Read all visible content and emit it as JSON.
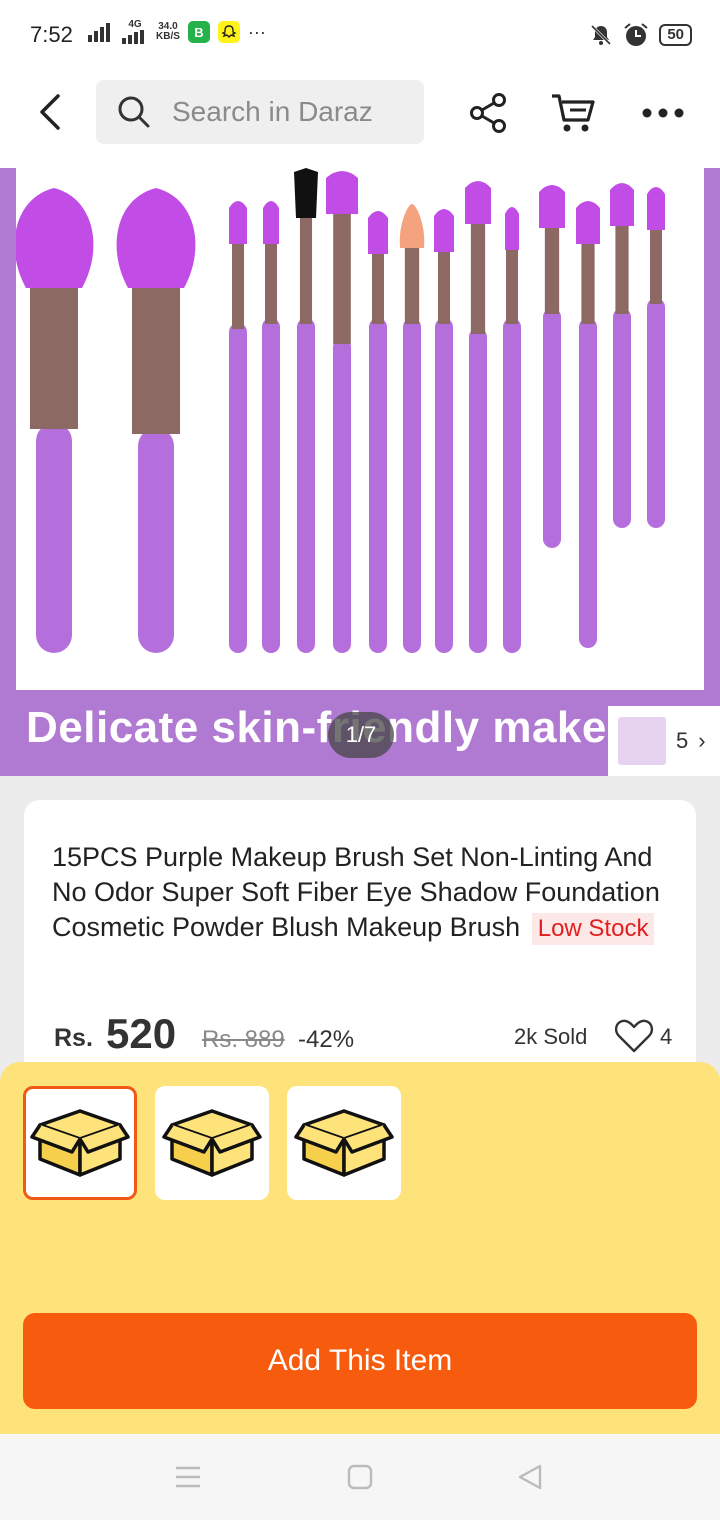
{
  "status_bar": {
    "time": "7:52",
    "network": "4G",
    "speed_value": "34.0",
    "speed_unit": "KB/S",
    "more": "···",
    "battery": "50"
  },
  "header": {
    "search_placeholder": "Search in Daraz",
    "icons": [
      "back-icon",
      "search-icon",
      "share-icon",
      "cart-icon",
      "more-icon"
    ]
  },
  "hero": {
    "caption": "Delicate skin-friendly make",
    "page_indicator": "1/7",
    "gallery_count": "5",
    "gallery_chevron": "›",
    "brush_color": "#b56fdc",
    "frame_color": "#b07ad2"
  },
  "product": {
    "title": "15PCS Purple Makeup Brush Set Non-Linting And No Odor Super Soft Fiber Eye Shadow Foundation Cosmetic Powder Blush Makeup Brush",
    "badge": "Low Stock",
    "currency": "Rs.",
    "price": "520",
    "old_price": "Rs. 889",
    "discount": "-42%",
    "sold": "2k Sold",
    "likes": "4"
  },
  "variants": {
    "count": 3,
    "selected_index": 0,
    "icon": "box-icon"
  },
  "sheet": {
    "add_label": "Add This Item",
    "accent": "#f75b0d",
    "background": "#fee27a"
  },
  "navbar": {
    "icons": [
      "menu-icon",
      "home-square-icon",
      "back-triangle-icon"
    ]
  }
}
